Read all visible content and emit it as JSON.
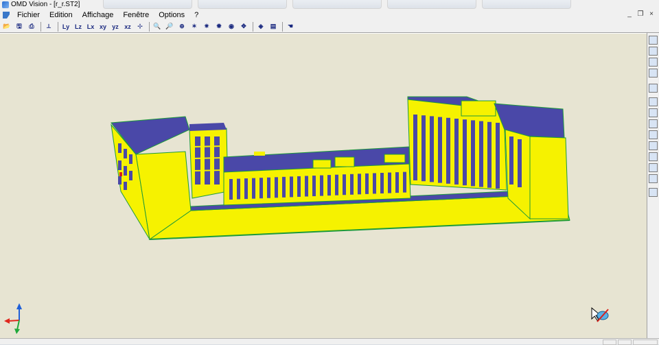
{
  "window": {
    "title": "OMD Vision - [r_r.ST2]"
  },
  "menubar": {
    "items": [
      "Fichier",
      "Edition",
      "Affichage",
      "Fenêtre",
      "Options",
      "?"
    ]
  },
  "window_controls": {
    "minimize": "_",
    "restore": "❐",
    "close": "×"
  },
  "toolbar": {
    "buttons": [
      {
        "name": "open-folder-icon",
        "glyph": "📂"
      },
      {
        "name": "save-icon",
        "glyph": "🖫"
      },
      {
        "name": "print-icon",
        "glyph": "⎙"
      },
      {
        "name": "axes-icon",
        "glyph": "⟂"
      },
      {
        "name": "view-y-icon",
        "glyph": "Ly"
      },
      {
        "name": "view-z-icon",
        "glyph": "Lz"
      },
      {
        "name": "view-x-icon",
        "glyph": "Lx"
      },
      {
        "name": "view-xy-icon",
        "glyph": "xy"
      },
      {
        "name": "view-yz-icon",
        "glyph": "yz"
      },
      {
        "name": "view-xz-icon",
        "glyph": "xz"
      },
      {
        "name": "view-3d-icon",
        "glyph": "⊹"
      },
      {
        "name": "zoom-in-icon",
        "glyph": "🔍"
      },
      {
        "name": "zoom-out-icon",
        "glyph": "🔎"
      },
      {
        "name": "zoom-window-icon",
        "glyph": "⊕"
      },
      {
        "name": "zoom-all-icon",
        "glyph": "✶"
      },
      {
        "name": "rotate-icon",
        "glyph": "✷"
      },
      {
        "name": "explode-icon",
        "glyph": "✹"
      },
      {
        "name": "eye-icon",
        "glyph": "◉"
      },
      {
        "name": "pan-icon",
        "glyph": "✥"
      },
      {
        "name": "render-icon",
        "glyph": "◈"
      },
      {
        "name": "layers-icon",
        "glyph": "▤"
      },
      {
        "name": "hand-icon",
        "glyph": "☚"
      }
    ]
  },
  "right_toolbar": {
    "buttons": [
      "light-icon",
      "copy-icon",
      "box-icon",
      "pages-icon",
      "grid-icon",
      "slab-icon",
      "beam-icon",
      "wall-icon",
      "column-icon",
      "pillar-icon",
      "pen-icon",
      "brush-icon",
      "node-icon",
      "check-icon"
    ]
  },
  "colors": {
    "canvas_bg": "#e7e4d2",
    "building_yellow": "#f6f200",
    "building_blue": "#4a48a8",
    "edge_green": "#1d9a3a",
    "axis_x": "#e0261c",
    "axis_y": "#1f5fd8",
    "axis_z": "#1fa83a"
  }
}
